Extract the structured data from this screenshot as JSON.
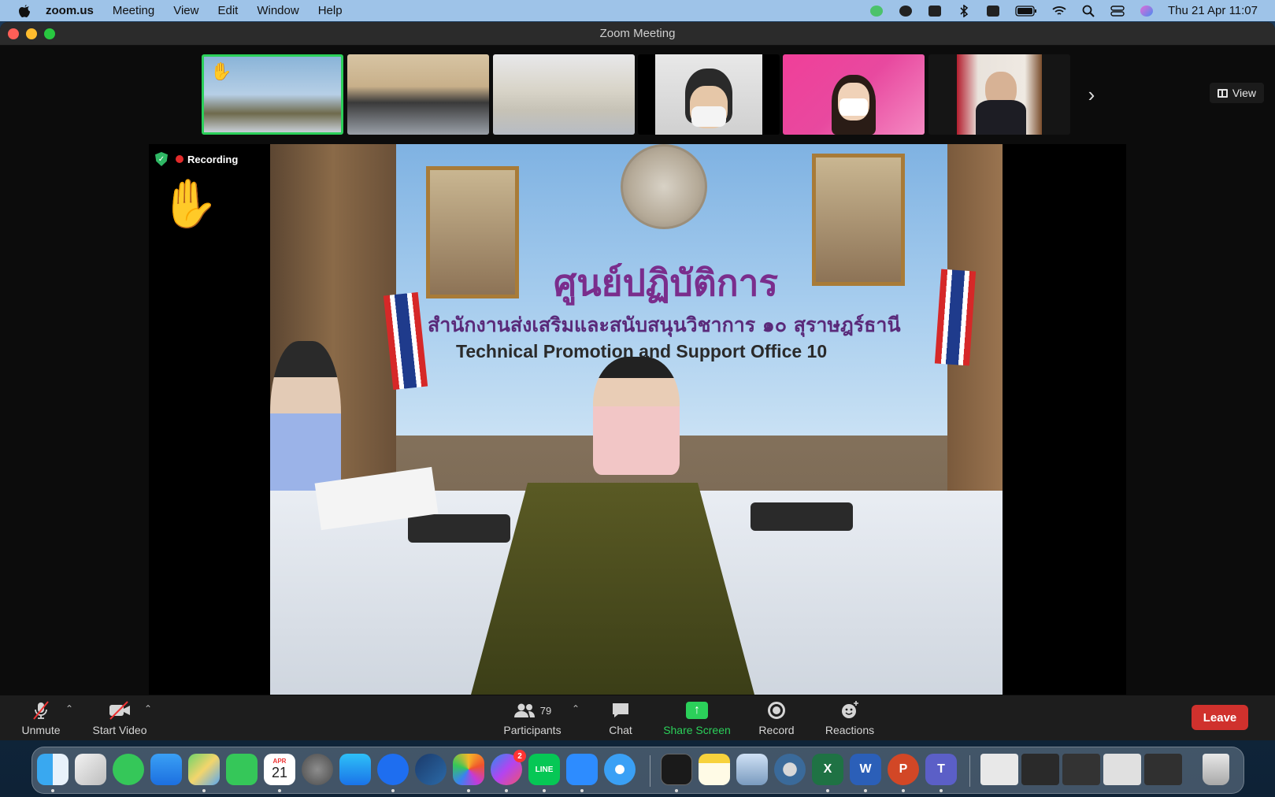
{
  "menubar": {
    "app_name": "zoom.us",
    "items": [
      "Meeting",
      "View",
      "Edit",
      "Window",
      "Help"
    ],
    "clock": "Thu 21 Apr  11:07"
  },
  "window": {
    "title": "Zoom Meeting"
  },
  "filmstrip": {
    "view_label": "View",
    "thumbnails": [
      "participant-1",
      "participant-2",
      "participant-3",
      "participant-4",
      "participant-5",
      "participant-6"
    ]
  },
  "main_video": {
    "recording_label": "Recording",
    "banner_thai_title": "ศูนย์ปฏิบัติการ",
    "banner_thai_subtitle": "สำนักงานส่งเสริมและสนับสนุนวิชาการ ๑๐ สุราษฎร์ธานี",
    "banner_english": "Technical Promotion and Support Office 10"
  },
  "toolbar": {
    "unmute": "Unmute",
    "start_video": "Start Video",
    "participants_count": "79",
    "participants": "Participants",
    "chat": "Chat",
    "share_screen": "Share Screen",
    "record": "Record",
    "reactions": "Reactions",
    "leave": "Leave"
  },
  "dock": {
    "calendar_month": "APR",
    "calendar_day": "21",
    "messenger_badge": "2",
    "line_label": "LINE",
    "excel_label": "X",
    "word_label": "W",
    "powerpoint_label": "P",
    "teams_label": "T"
  },
  "colors": {
    "menubar": "#9ec3e8",
    "active_speaker_border": "#2bd05a",
    "leave_button": "#d0312d",
    "share_screen": "#2bd05a"
  }
}
